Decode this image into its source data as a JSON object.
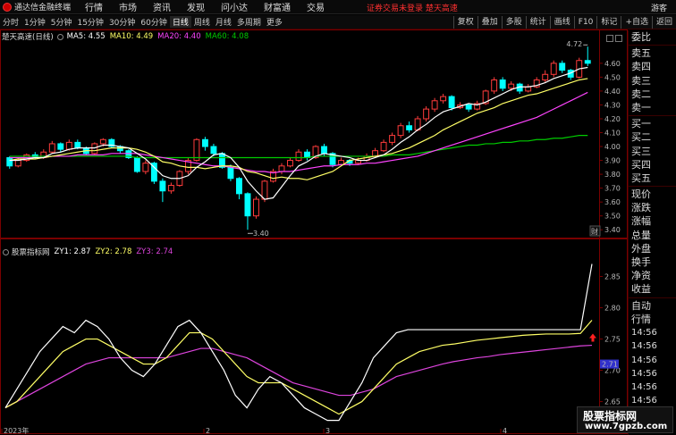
{
  "app": {
    "title": "通达信金融终端"
  },
  "menu": [
    "行情",
    "市场",
    "资讯",
    "发现",
    "问小达",
    "财富通",
    "交易"
  ],
  "alert": "证券交易未登录 楚天高速",
  "guest": "游客",
  "period_tabs": [
    "分时",
    "1分钟",
    "5分钟",
    "15分钟",
    "30分钟",
    "60分钟",
    "日线",
    "周线",
    "月线",
    "多周期",
    "更多"
  ],
  "active_tab": "日线",
  "right_tools": [
    "复权",
    "叠加",
    "多股",
    "统计",
    "画线",
    "F10",
    "标记",
    "+自选",
    "返回"
  ],
  "colors": {
    "up": "#ff3c3c",
    "down": "#00ffff",
    "ma5": "#ffffff",
    "ma10": "#ffff66",
    "ma20": "#ff44ff",
    "ma60": "#00cc00",
    "zy1": "#ffffff",
    "zy2": "#ffff66",
    "zy3": "#dd44dd",
    "frame": "#7a0000"
  },
  "main_panel": {
    "title": "楚天高速(日线)",
    "ma5": "MA5: 4.55",
    "ma10": "MA10: 4.49",
    "ma20": "MA20: 4.40",
    "ma60": "MA60: 4.08",
    "y_ticks": [
      "4.60",
      "4.50",
      "4.40",
      "4.30",
      "4.20",
      "4.10",
      "4.00",
      "3.90",
      "3.80",
      "3.70",
      "3.60",
      "3.50",
      "3.40"
    ],
    "high_label": "4.72",
    "low_label": "3.40",
    "badge": "财",
    "candles": [
      [
        3.92,
        3.86,
        3.93,
        3.84
      ],
      [
        3.86,
        3.9,
        3.92,
        3.85
      ],
      [
        3.9,
        3.94,
        3.95,
        3.89
      ],
      [
        3.94,
        3.92,
        3.96,
        3.91
      ],
      [
        3.92,
        3.96,
        3.98,
        3.91
      ],
      [
        3.96,
        4.02,
        4.04,
        3.95
      ],
      [
        4.02,
        3.98,
        4.03,
        3.96
      ],
      [
        3.98,
        4.03,
        4.05,
        3.97
      ],
      [
        4.03,
        3.99,
        4.05,
        3.98
      ],
      [
        3.99,
        3.95,
        4.0,
        3.94
      ],
      [
        3.95,
        4.02,
        4.03,
        3.94
      ],
      [
        4.02,
        4.05,
        4.06,
        4.0
      ],
      [
        4.05,
        4.0,
        4.06,
        3.99
      ],
      [
        4.0,
        3.97,
        4.01,
        3.95
      ],
      [
        3.97,
        3.92,
        3.98,
        3.91
      ],
      [
        3.92,
        3.82,
        3.93,
        3.81
      ],
      [
        3.82,
        3.88,
        3.9,
        3.8
      ],
      [
        3.88,
        3.75,
        3.89,
        3.73
      ],
      [
        3.75,
        3.68,
        3.77,
        3.6
      ],
      [
        3.68,
        3.72,
        3.74,
        3.66
      ],
      [
        3.72,
        3.82,
        3.83,
        3.71
      ],
      [
        3.82,
        3.9,
        3.92,
        3.8
      ],
      [
        3.9,
        4.05,
        4.06,
        3.89
      ],
      [
        4.05,
        4.0,
        4.07,
        3.97
      ],
      [
        4.0,
        3.95,
        4.02,
        3.93
      ],
      [
        3.95,
        3.85,
        3.96,
        3.84
      ],
      [
        3.85,
        3.77,
        3.87,
        3.75
      ],
      [
        3.77,
        3.66,
        3.78,
        3.62
      ],
      [
        3.66,
        3.5,
        3.67,
        3.4
      ],
      [
        3.5,
        3.62,
        3.64,
        3.48
      ],
      [
        3.62,
        3.75,
        3.76,
        3.6
      ],
      [
        3.75,
        3.82,
        3.84,
        3.74
      ],
      [
        3.82,
        3.86,
        3.88,
        3.8
      ],
      [
        3.86,
        3.9,
        3.92,
        3.85
      ],
      [
        3.9,
        3.96,
        3.98,
        3.89
      ],
      [
        3.96,
        3.92,
        3.98,
        3.9
      ],
      [
        3.92,
        4.0,
        4.01,
        3.91
      ],
      [
        4.0,
        3.95,
        4.02,
        3.93
      ],
      [
        3.95,
        3.87,
        3.96,
        3.85
      ],
      [
        3.87,
        3.9,
        3.92,
        3.86
      ],
      [
        3.9,
        3.88,
        3.91,
        3.86
      ],
      [
        3.88,
        3.9,
        3.92,
        3.87
      ],
      [
        3.9,
        3.93,
        3.95,
        3.89
      ],
      [
        3.93,
        3.97,
        3.99,
        3.92
      ],
      [
        3.97,
        4.03,
        4.05,
        3.96
      ],
      [
        4.03,
        4.08,
        4.1,
        4.01
      ],
      [
        4.08,
        4.15,
        4.17,
        4.06
      ],
      [
        4.15,
        4.12,
        4.18,
        4.1
      ],
      [
        4.12,
        4.2,
        4.22,
        4.11
      ],
      [
        4.2,
        4.27,
        4.29,
        4.18
      ],
      [
        4.27,
        4.33,
        4.35,
        4.25
      ],
      [
        4.33,
        4.36,
        4.38,
        4.31
      ],
      [
        4.36,
        4.28,
        4.37,
        4.26
      ],
      [
        4.28,
        4.3,
        4.32,
        4.27
      ],
      [
        4.3,
        4.27,
        4.31,
        4.25
      ],
      [
        4.27,
        4.31,
        4.33,
        4.26
      ],
      [
        4.31,
        4.4,
        4.41,
        4.3
      ],
      [
        4.4,
        4.48,
        4.5,
        4.38
      ],
      [
        4.48,
        4.42,
        4.5,
        4.4
      ],
      [
        4.42,
        4.45,
        4.47,
        4.4
      ],
      [
        4.45,
        4.4,
        4.46,
        4.38
      ],
      [
        4.4,
        4.43,
        4.45,
        4.39
      ],
      [
        4.43,
        4.48,
        4.5,
        4.42
      ],
      [
        4.48,
        4.52,
        4.55,
        4.46
      ],
      [
        4.52,
        4.6,
        4.62,
        4.5
      ],
      [
        4.6,
        4.55,
        4.62,
        4.53
      ],
      [
        4.55,
        4.5,
        4.56,
        4.48
      ],
      [
        4.5,
        4.62,
        4.64,
        4.49
      ],
      [
        4.62,
        4.6,
        4.72,
        4.58
      ]
    ],
    "ma5_vals": [
      3.9,
      3.9,
      3.91,
      3.92,
      3.92,
      3.95,
      3.96,
      3.98,
      3.99,
      3.99,
      3.99,
      4.01,
      4.01,
      4.0,
      3.99,
      3.95,
      3.91,
      3.85,
      3.79,
      3.77,
      3.77,
      3.79,
      3.85,
      3.89,
      3.94,
      3.95,
      3.92,
      3.85,
      3.75,
      3.68,
      3.62,
      3.63,
      3.71,
      3.79,
      3.86,
      3.89,
      3.93,
      3.95,
      3.94,
      3.93,
      3.92,
      3.9,
      3.9,
      3.92,
      3.94,
      3.98,
      4.03,
      4.07,
      4.12,
      4.16,
      4.21,
      4.25,
      4.27,
      4.29,
      4.31,
      4.3,
      4.32,
      4.35,
      4.38,
      4.41,
      4.43,
      4.43,
      4.44,
      4.46,
      4.49,
      4.51,
      4.53,
      4.56,
      4.57
    ],
    "ma10_vals": [
      3.9,
      3.91,
      3.91,
      3.91,
      3.92,
      3.93,
      3.94,
      3.95,
      3.96,
      3.97,
      3.97,
      3.98,
      3.99,
      3.99,
      3.99,
      3.98,
      3.96,
      3.93,
      3.89,
      3.88,
      3.86,
      3.85,
      3.85,
      3.84,
      3.85,
      3.86,
      3.86,
      3.85,
      3.82,
      3.81,
      3.79,
      3.77,
      3.78,
      3.77,
      3.77,
      3.76,
      3.78,
      3.8,
      3.82,
      3.86,
      3.9,
      3.91,
      3.92,
      3.93,
      3.94,
      3.95,
      3.97,
      3.99,
      4.02,
      4.05,
      4.08,
      4.12,
      4.15,
      4.18,
      4.21,
      4.24,
      4.26,
      4.28,
      4.31,
      4.33,
      4.35,
      4.37,
      4.38,
      4.4,
      4.42,
      4.44,
      4.46,
      4.48,
      4.49
    ],
    "ma20_vals": [
      3.92,
      3.92,
      3.92,
      3.92,
      3.92,
      3.93,
      3.93,
      3.93,
      3.94,
      3.94,
      3.94,
      3.94,
      3.95,
      3.95,
      3.95,
      3.95,
      3.94,
      3.93,
      3.92,
      3.91,
      3.9,
      3.89,
      3.88,
      3.87,
      3.86,
      3.86,
      3.85,
      3.84,
      3.83,
      3.82,
      3.82,
      3.81,
      3.82,
      3.82,
      3.83,
      3.84,
      3.85,
      3.86,
      3.86,
      3.87,
      3.87,
      3.87,
      3.88,
      3.88,
      3.89,
      3.9,
      3.91,
      3.92,
      3.93,
      3.95,
      3.97,
      3.99,
      4.01,
      4.03,
      4.05,
      4.07,
      4.09,
      4.11,
      4.13,
      4.15,
      4.17,
      4.19,
      4.21,
      4.24,
      4.27,
      4.3,
      4.33,
      4.36,
      4.39
    ],
    "ma60_vals": [
      3.93,
      3.93,
      3.93,
      3.93,
      3.93,
      3.93,
      3.93,
      3.93,
      3.93,
      3.93,
      3.93,
      3.93,
      3.93,
      3.93,
      3.93,
      3.92,
      3.92,
      3.92,
      3.92,
      3.92,
      3.92,
      3.92,
      3.92,
      3.92,
      3.92,
      3.92,
      3.92,
      3.92,
      3.92,
      3.92,
      3.92,
      3.92,
      3.92,
      3.92,
      3.92,
      3.92,
      3.93,
      3.93,
      3.93,
      3.93,
      3.93,
      3.93,
      3.93,
      3.93,
      3.93,
      3.94,
      3.94,
      3.94,
      3.95,
      3.96,
      3.97,
      3.98,
      3.99,
      4.0,
      4.01,
      4.01,
      4.02,
      4.02,
      4.03,
      4.03,
      4.04,
      4.04,
      4.05,
      4.05,
      4.06,
      4.06,
      4.07,
      4.08,
      4.08
    ]
  },
  "sub_panel": {
    "title": "股票指标网",
    "zy1": "ZY1: 2.87",
    "zy2": "ZY2: 2.78",
    "zy3": "ZY3: 2.74",
    "y_ticks": [
      "2.85",
      "2.80",
      "2.75",
      "2.70",
      "2.65"
    ],
    "marker": "2.71",
    "zy1_vals": [
      2.64,
      2.67,
      2.7,
      2.73,
      2.75,
      2.77,
      2.76,
      2.78,
      2.77,
      2.75,
      2.72,
      2.7,
      2.69,
      2.71,
      2.74,
      2.77,
      2.78,
      2.76,
      2.73,
      2.7,
      2.66,
      2.64,
      2.67,
      2.69,
      2.68,
      2.66,
      2.64,
      2.63,
      2.62,
      2.62,
      2.65,
      2.68,
      2.72,
      2.74,
      2.76,
      2.765,
      2.765,
      2.765,
      2.765,
      2.765,
      2.765,
      2.765,
      2.765,
      2.765,
      2.765,
      2.765,
      2.765,
      2.765,
      2.765,
      2.765,
      2.765,
      2.87
    ],
    "zy2_vals": [
      2.64,
      2.65,
      2.67,
      2.69,
      2.71,
      2.73,
      2.74,
      2.75,
      2.75,
      2.74,
      2.73,
      2.72,
      2.71,
      2.71,
      2.72,
      2.74,
      2.76,
      2.76,
      2.75,
      2.73,
      2.71,
      2.69,
      2.68,
      2.68,
      2.68,
      2.67,
      2.66,
      2.65,
      2.64,
      2.63,
      2.64,
      2.65,
      2.67,
      2.69,
      2.71,
      2.72,
      2.73,
      2.735,
      2.74,
      2.742,
      2.745,
      2.748,
      2.75,
      2.752,
      2.754,
      2.756,
      2.757,
      2.758,
      2.758,
      2.758,
      2.759,
      2.78
    ],
    "zy3_vals": [
      2.64,
      2.65,
      2.66,
      2.67,
      2.68,
      2.69,
      2.7,
      2.71,
      2.715,
      2.72,
      2.72,
      2.72,
      2.72,
      2.72,
      2.72,
      2.725,
      2.73,
      2.735,
      2.735,
      2.73,
      2.725,
      2.72,
      2.71,
      2.7,
      2.69,
      2.68,
      2.675,
      2.67,
      2.665,
      2.66,
      2.66,
      2.665,
      2.67,
      2.68,
      2.69,
      2.695,
      2.7,
      2.705,
      2.71,
      2.714,
      2.717,
      2.72,
      2.722,
      2.725,
      2.727,
      2.729,
      2.731,
      2.733,
      2.735,
      2.737,
      2.739,
      2.74
    ],
    "x_labels": [
      "2023年",
      "2",
      "3",
      "4"
    ]
  },
  "quote_panel": {
    "labels": [
      "委比",
      "卖五",
      "卖四",
      "卖三",
      "卖二",
      "卖一",
      "买一",
      "买二",
      "买三",
      "买四",
      "买五",
      "现价",
      "涨跌",
      "涨幅",
      "总量",
      "外盘",
      "换手",
      "净资",
      "收益",
      "自动",
      "行情"
    ],
    "times": [
      "14:56",
      "14:56",
      "14:56",
      "14:56",
      "14:56",
      "14:56",
      "14:56",
      "14:56"
    ]
  },
  "watermark": {
    "line1": "股票指标网",
    "line2": "www.7gpzb.com"
  }
}
